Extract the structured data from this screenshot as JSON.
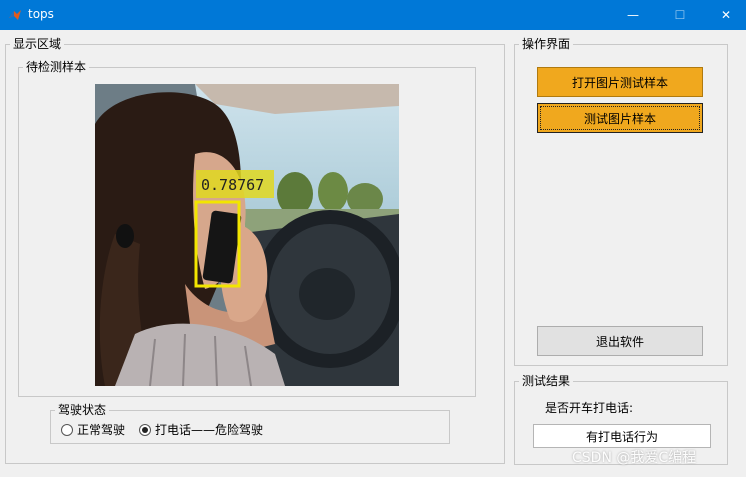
{
  "window": {
    "title": "tops",
    "minimize_glyph": "—",
    "maximize_glyph": "☐",
    "close_glyph": "✕"
  },
  "display_area": {
    "title": "显示区域",
    "sample_panel": {
      "title": "待检测样本",
      "detection_score": "0.78767",
      "box_color": "#f2e600"
    },
    "drive_state": {
      "title": "驾驶状态",
      "options": [
        {
          "label": "正常驾驶",
          "selected": false
        },
        {
          "label": "打电话——危险驾驶",
          "selected": true
        }
      ]
    }
  },
  "operations": {
    "title": "操作界面",
    "open_button": "打开图片测试样本",
    "test_button": "测试图片样本",
    "exit_button": "退出软件"
  },
  "result": {
    "title": "测试结果",
    "question": "是否开车打电话:",
    "value": "有打电话行为"
  },
  "watermark": "CSDN @我爱C编程",
  "colors": {
    "titlebar": "#0078d7",
    "accent_button": "#f0a81e",
    "background": "#f0f0f0"
  }
}
